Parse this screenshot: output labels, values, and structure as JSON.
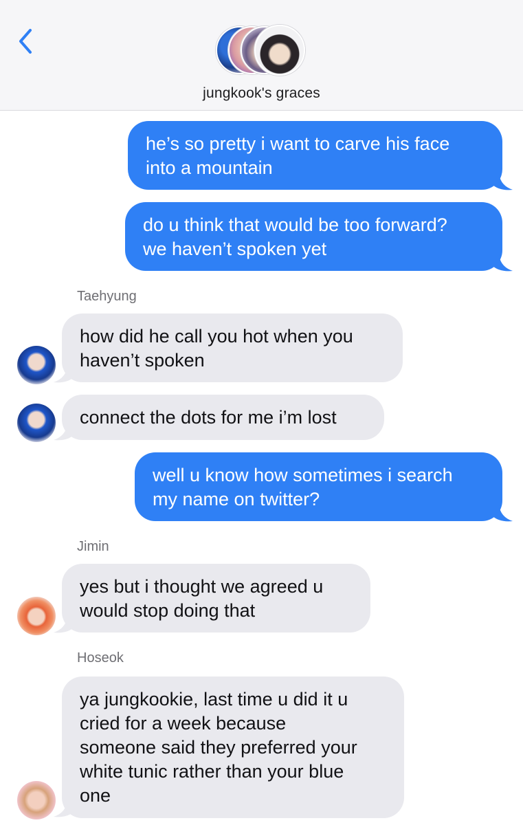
{
  "header": {
    "title": "jungkook's graces",
    "back_icon": "chevron-left-icon",
    "accent": "#2f80f5"
  },
  "messages": [
    {
      "type": "out",
      "text": "he’s so pretty i want to carve his face\ninto a mountain"
    },
    {
      "type": "out",
      "text": "do u think that would be too forward?\nwe haven’t spoken yet"
    },
    {
      "type": "in",
      "sender": "Taehyung",
      "text": "how did he call you hot when you\nhaven’t spoken"
    },
    {
      "type": "in",
      "text": "connect the dots for me i’m lost"
    },
    {
      "type": "out",
      "text": "well u know how sometimes i search\nmy name on twitter?"
    },
    {
      "type": "in",
      "sender": "Jimin",
      "text": "yes but i thought we agreed u\nwould stop doing that"
    },
    {
      "type": "in",
      "sender": "Hoseok",
      "text": "ya jungkookie, last time u did it u\ncried for a week because\nsomeone said they preferred your\nwhite tunic rather than your blue\none"
    }
  ],
  "colors": {
    "outgoing_bubble": "#2f80f5",
    "incoming_bubble": "#e9e9ee",
    "header_bg": "#f6f6f8"
  }
}
